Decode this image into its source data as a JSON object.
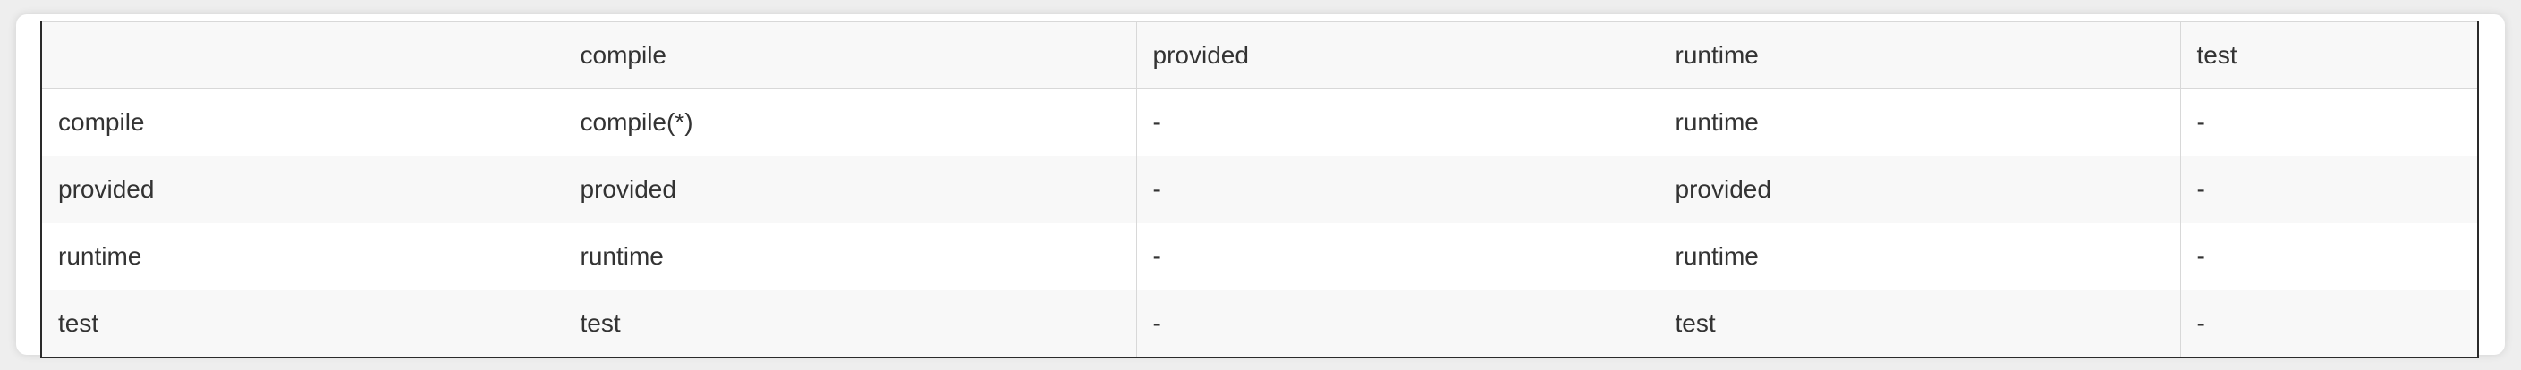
{
  "table": {
    "header": [
      "",
      "compile",
      "provided",
      "runtime",
      "test"
    ],
    "rows": [
      [
        "compile",
        "compile(*)",
        "-",
        "runtime",
        "-"
      ],
      [
        "provided",
        "provided",
        "-",
        "provided",
        "-"
      ],
      [
        "runtime",
        "runtime",
        "-",
        "runtime",
        "-"
      ],
      [
        "test",
        "test",
        "-",
        "test",
        "-"
      ]
    ]
  }
}
